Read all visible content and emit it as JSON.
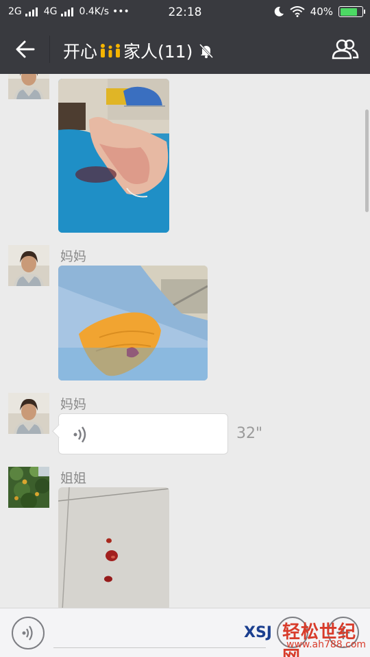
{
  "status_bar": {
    "net1": "2G",
    "net2": "4G",
    "speed": "0.4K/s",
    "dots": "•••",
    "time": "22:18",
    "battery": "40%"
  },
  "header": {
    "title_part1": "开心",
    "title_part2": "家人(11)",
    "family_emoji": "👪",
    "muted_icon": "bell-off-icon"
  },
  "messages": [
    {
      "type": "image",
      "sender": "",
      "desc": "bandaged foot photo 1"
    },
    {
      "type": "image",
      "sender": "妈妈",
      "desc": "bandaged foot photo 2"
    },
    {
      "type": "voice",
      "sender": "妈妈",
      "duration": "32\""
    },
    {
      "type": "image",
      "sender": "姐姐",
      "desc": "floor photo"
    }
  ],
  "input": {
    "placeholder": ""
  },
  "watermark": {
    "logo": "XSJ",
    "text": "轻松世纪网",
    "url": "www.ah788.com"
  }
}
